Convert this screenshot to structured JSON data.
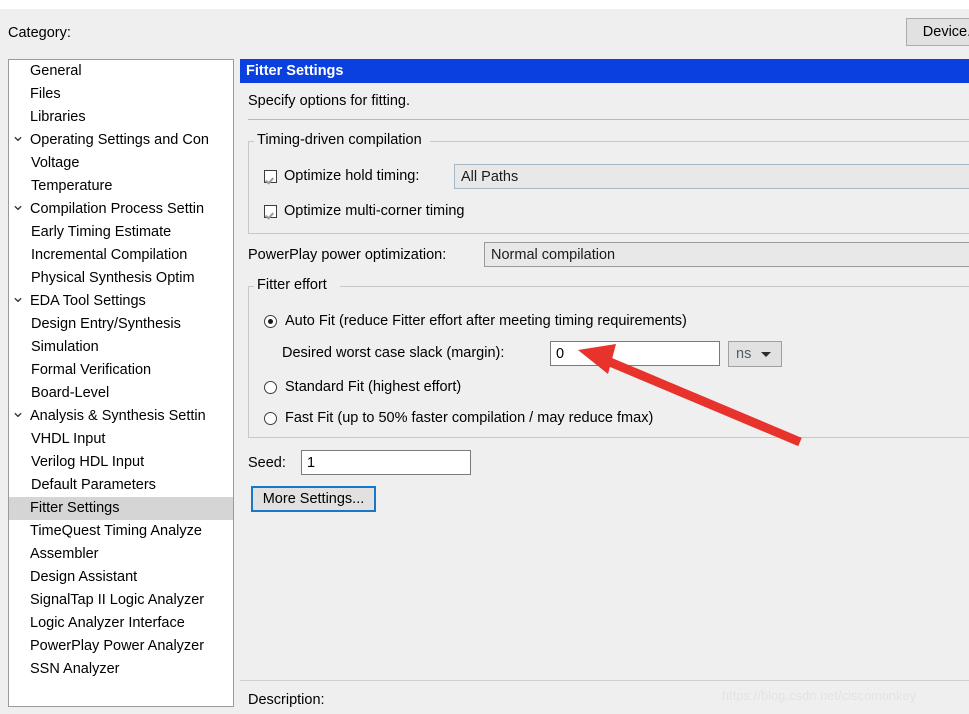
{
  "window": {
    "category_label": "Category:",
    "device_button": "Device..."
  },
  "tree": {
    "items": [
      {
        "label": "General",
        "level": 0,
        "twisty": "",
        "selected": false
      },
      {
        "label": "Files",
        "level": 0,
        "twisty": "",
        "selected": false
      },
      {
        "label": "Libraries",
        "level": 0,
        "twisty": "",
        "selected": false
      },
      {
        "label": "Operating Settings and Con",
        "level": 0,
        "twisty": "expanded",
        "selected": false
      },
      {
        "label": "Voltage",
        "level": 1,
        "twisty": "",
        "selected": false
      },
      {
        "label": "Temperature",
        "level": 1,
        "twisty": "",
        "selected": false
      },
      {
        "label": "Compilation Process Settin",
        "level": 0,
        "twisty": "expanded",
        "selected": false
      },
      {
        "label": "Early Timing Estimate",
        "level": 1,
        "twisty": "",
        "selected": false
      },
      {
        "label": "Incremental Compilation",
        "level": 1,
        "twisty": "",
        "selected": false
      },
      {
        "label": "Physical Synthesis Optim",
        "level": 1,
        "twisty": "",
        "selected": false
      },
      {
        "label": "EDA Tool Settings",
        "level": 0,
        "twisty": "expanded",
        "selected": false
      },
      {
        "label": "Design Entry/Synthesis",
        "level": 1,
        "twisty": "",
        "selected": false
      },
      {
        "label": "Simulation",
        "level": 1,
        "twisty": "",
        "selected": false
      },
      {
        "label": "Formal Verification",
        "level": 1,
        "twisty": "",
        "selected": false
      },
      {
        "label": "Board-Level",
        "level": 1,
        "twisty": "",
        "selected": false
      },
      {
        "label": "Analysis & Synthesis Settin",
        "level": 0,
        "twisty": "expanded",
        "selected": false
      },
      {
        "label": "VHDL Input",
        "level": 1,
        "twisty": "",
        "selected": false
      },
      {
        "label": "Verilog HDL Input",
        "level": 1,
        "twisty": "",
        "selected": false
      },
      {
        "label": "Default Parameters",
        "level": 1,
        "twisty": "",
        "selected": false
      },
      {
        "label": "Fitter Settings",
        "level": 0,
        "twisty": "",
        "selected": true
      },
      {
        "label": "TimeQuest Timing Analyze",
        "level": 0,
        "twisty": "",
        "selected": false
      },
      {
        "label": "Assembler",
        "level": 0,
        "twisty": "",
        "selected": false
      },
      {
        "label": "Design Assistant",
        "level": 0,
        "twisty": "",
        "selected": false
      },
      {
        "label": "SignalTap II Logic Analyzer",
        "level": 0,
        "twisty": "",
        "selected": false
      },
      {
        "label": "Logic Analyzer Interface",
        "level": 0,
        "twisty": "",
        "selected": false
      },
      {
        "label": "PowerPlay Power Analyzer",
        "level": 0,
        "twisty": "",
        "selected": false
      },
      {
        "label": "SSN Analyzer",
        "level": 0,
        "twisty": "",
        "selected": false
      }
    ]
  },
  "panel": {
    "title": "Fitter Settings",
    "subtitle": "Specify options for fitting.",
    "timing_group": {
      "legend": "Timing-driven compilation",
      "optimize_hold_label": "Optimize hold timing:",
      "optimize_hold_checked": true,
      "optimize_hold_value": "All Paths",
      "optimize_multicorner_label": "Optimize multi-corner timing",
      "optimize_multicorner_checked": true
    },
    "powerplay": {
      "label": "PowerPlay power optimization:",
      "value": "Normal compilation"
    },
    "fitter_effort": {
      "legend": "Fitter effort",
      "options": [
        {
          "label": "Auto Fit (reduce Fitter effort after meeting timing requirements)",
          "selected": true
        },
        {
          "label": "Standard Fit (highest effort)",
          "selected": false
        },
        {
          "label": "Fast Fit (up to 50% faster compilation / may reduce fmax)",
          "selected": false
        }
      ],
      "slack_label": "Desired worst case slack (margin):",
      "slack_value": "0",
      "slack_unit": "ns"
    },
    "seed_label": "Seed:",
    "seed_value": "1",
    "more_settings_button": "More Settings...",
    "description_label": "Description:"
  },
  "annotation": {
    "arrow_color": "#e8322c"
  },
  "watermark": {
    "text": "https://blog.csdn.net/ciscomonkey"
  }
}
